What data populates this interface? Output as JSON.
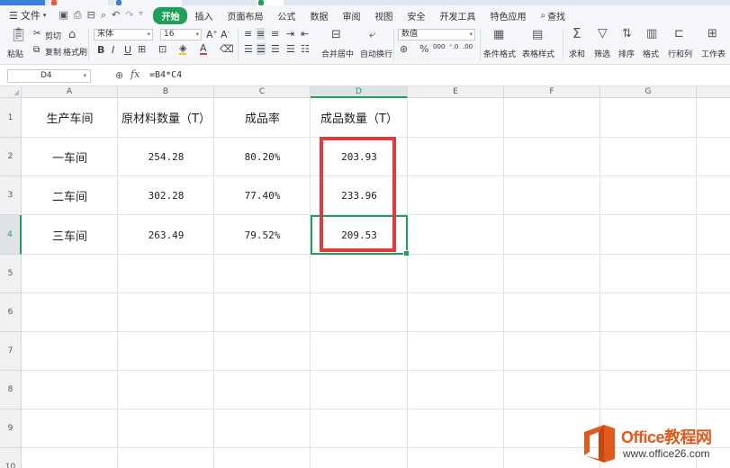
{
  "menu": {
    "file_label": "文件",
    "tabs": [
      {
        "label": "开始",
        "active": true
      },
      {
        "label": "插入",
        "active": false
      },
      {
        "label": "页面布局",
        "active": false
      },
      {
        "label": "公式",
        "active": false
      },
      {
        "label": "数据",
        "active": false
      },
      {
        "label": "审阅",
        "active": false
      },
      {
        "label": "视图",
        "active": false
      },
      {
        "label": "安全",
        "active": false
      },
      {
        "label": "开发工具",
        "active": false
      },
      {
        "label": "特色应用",
        "active": false
      }
    ],
    "search_label": "查找"
  },
  "ribbon": {
    "paste": "粘贴",
    "cut": "剪切",
    "copy": "复制",
    "format_painter": "格式刷",
    "font_name": "宋体",
    "font_size": "16",
    "number_format": "数值",
    "merge_center": "合并居中",
    "wrap_text": "自动换行",
    "conditional_format": "条件格式",
    "table_style": "表格样式",
    "sum": "求和",
    "filter": "筛选",
    "sort": "排序",
    "format": "格式",
    "rows_cols": "行和列",
    "worksheet": "工作表",
    "percent_symbol": "%",
    "thousands_symbol": "000"
  },
  "formula_bar": {
    "cell_ref": "D4",
    "fx": "fx",
    "formula": "=B4*C4"
  },
  "columns": [
    "A",
    "B",
    "C",
    "D",
    "E",
    "F",
    "G"
  ],
  "rows": [
    "1",
    "2",
    "3",
    "4",
    "5",
    "6",
    "7",
    "8",
    "9",
    "10"
  ],
  "table": {
    "headers": [
      "生产车间",
      "原材料数量（T）",
      "成品率",
      "成品数量（T）"
    ],
    "rows": [
      [
        "一车间",
        "254.28",
        "80.20%",
        "203.93"
      ],
      [
        "二车间",
        "302.28",
        "77.40%",
        "233.96"
      ],
      [
        "三车间",
        "263.49",
        "79.52%",
        "209.53"
      ]
    ]
  },
  "watermark": {
    "brand": "Office教程网",
    "url": "www.office26.com"
  },
  "colors": {
    "accent_green": "#1fa05a",
    "highlight_red": "#e03b3f",
    "logo_orange": "#e05a1d"
  }
}
